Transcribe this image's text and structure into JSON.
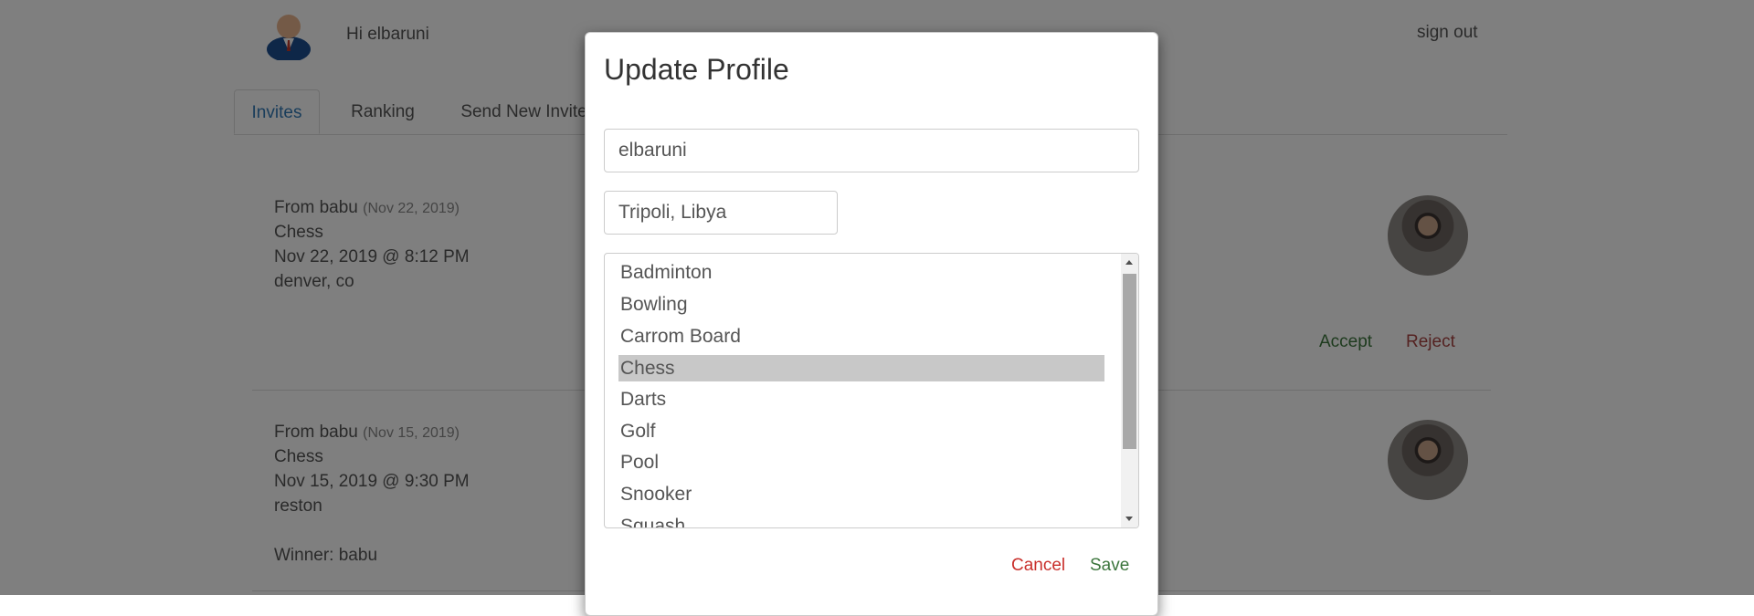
{
  "header": {
    "greeting": "Hi elbaruni",
    "signout_label": "sign out"
  },
  "tabs": [
    {
      "label": "Invites",
      "active": true
    },
    {
      "label": "Ranking",
      "active": false
    },
    {
      "label": "Send New Invite",
      "active": false
    }
  ],
  "invites": [
    {
      "from": "From babu",
      "sent_date": "(Nov 22, 2019)",
      "game": "Chess",
      "when": "Nov 22, 2019 @ 8:12 PM",
      "location": "denver, co",
      "accept_label": "Accept",
      "reject_label": "Reject"
    },
    {
      "from": "From babu",
      "sent_date": "(Nov 15, 2019)",
      "game": "Chess",
      "when": "Nov 15, 2019 @ 9:30 PM",
      "location": "reston",
      "winner_label": "Winner: babu"
    }
  ],
  "modal": {
    "title": "Update Profile",
    "name_value": "elbaruni",
    "location_value": "Tripoli, Libya",
    "sports_options": [
      "Badminton",
      "Bowling",
      "Carrom Board",
      "Chess",
      "Darts",
      "Golf",
      "Pool",
      "Snooker",
      "Squash"
    ],
    "selected_sport": "Chess",
    "cancel_label": "Cancel",
    "save_label": "Save"
  },
  "colors": {
    "link_blue": "#337ab7",
    "accept_green": "#3c763d",
    "reject_red": "#a94442",
    "cancel_red": "#c9302c"
  }
}
